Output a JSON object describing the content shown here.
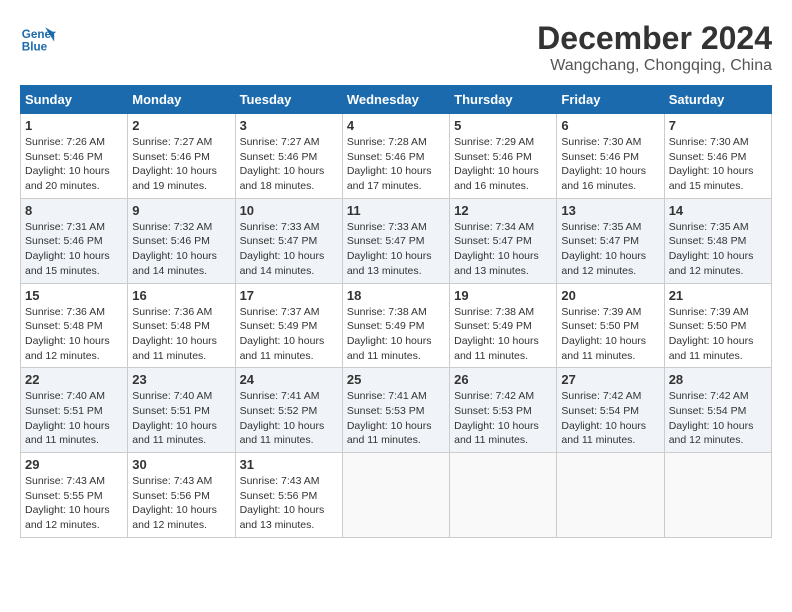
{
  "header": {
    "logo_line1": "General",
    "logo_line2": "Blue",
    "month": "December 2024",
    "location": "Wangchang, Chongqing, China"
  },
  "weekdays": [
    "Sunday",
    "Monday",
    "Tuesday",
    "Wednesday",
    "Thursday",
    "Friday",
    "Saturday"
  ],
  "weeks": [
    [
      {
        "day": "1",
        "info": "Sunrise: 7:26 AM\nSunset: 5:46 PM\nDaylight: 10 hours\nand 20 minutes."
      },
      {
        "day": "2",
        "info": "Sunrise: 7:27 AM\nSunset: 5:46 PM\nDaylight: 10 hours\nand 19 minutes."
      },
      {
        "day": "3",
        "info": "Sunrise: 7:27 AM\nSunset: 5:46 PM\nDaylight: 10 hours\nand 18 minutes."
      },
      {
        "day": "4",
        "info": "Sunrise: 7:28 AM\nSunset: 5:46 PM\nDaylight: 10 hours\nand 17 minutes."
      },
      {
        "day": "5",
        "info": "Sunrise: 7:29 AM\nSunset: 5:46 PM\nDaylight: 10 hours\nand 16 minutes."
      },
      {
        "day": "6",
        "info": "Sunrise: 7:30 AM\nSunset: 5:46 PM\nDaylight: 10 hours\nand 16 minutes."
      },
      {
        "day": "7",
        "info": "Sunrise: 7:30 AM\nSunset: 5:46 PM\nDaylight: 10 hours\nand 15 minutes."
      }
    ],
    [
      {
        "day": "8",
        "info": "Sunrise: 7:31 AM\nSunset: 5:46 PM\nDaylight: 10 hours\nand 15 minutes."
      },
      {
        "day": "9",
        "info": "Sunrise: 7:32 AM\nSunset: 5:46 PM\nDaylight: 10 hours\nand 14 minutes."
      },
      {
        "day": "10",
        "info": "Sunrise: 7:33 AM\nSunset: 5:47 PM\nDaylight: 10 hours\nand 14 minutes."
      },
      {
        "day": "11",
        "info": "Sunrise: 7:33 AM\nSunset: 5:47 PM\nDaylight: 10 hours\nand 13 minutes."
      },
      {
        "day": "12",
        "info": "Sunrise: 7:34 AM\nSunset: 5:47 PM\nDaylight: 10 hours\nand 13 minutes."
      },
      {
        "day": "13",
        "info": "Sunrise: 7:35 AM\nSunset: 5:47 PM\nDaylight: 10 hours\nand 12 minutes."
      },
      {
        "day": "14",
        "info": "Sunrise: 7:35 AM\nSunset: 5:48 PM\nDaylight: 10 hours\nand 12 minutes."
      }
    ],
    [
      {
        "day": "15",
        "info": "Sunrise: 7:36 AM\nSunset: 5:48 PM\nDaylight: 10 hours\nand 12 minutes."
      },
      {
        "day": "16",
        "info": "Sunrise: 7:36 AM\nSunset: 5:48 PM\nDaylight: 10 hours\nand 11 minutes."
      },
      {
        "day": "17",
        "info": "Sunrise: 7:37 AM\nSunset: 5:49 PM\nDaylight: 10 hours\nand 11 minutes."
      },
      {
        "day": "18",
        "info": "Sunrise: 7:38 AM\nSunset: 5:49 PM\nDaylight: 10 hours\nand 11 minutes."
      },
      {
        "day": "19",
        "info": "Sunrise: 7:38 AM\nSunset: 5:49 PM\nDaylight: 10 hours\nand 11 minutes."
      },
      {
        "day": "20",
        "info": "Sunrise: 7:39 AM\nSunset: 5:50 PM\nDaylight: 10 hours\nand 11 minutes."
      },
      {
        "day": "21",
        "info": "Sunrise: 7:39 AM\nSunset: 5:50 PM\nDaylight: 10 hours\nand 11 minutes."
      }
    ],
    [
      {
        "day": "22",
        "info": "Sunrise: 7:40 AM\nSunset: 5:51 PM\nDaylight: 10 hours\nand 11 minutes."
      },
      {
        "day": "23",
        "info": "Sunrise: 7:40 AM\nSunset: 5:51 PM\nDaylight: 10 hours\nand 11 minutes."
      },
      {
        "day": "24",
        "info": "Sunrise: 7:41 AM\nSunset: 5:52 PM\nDaylight: 10 hours\nand 11 minutes."
      },
      {
        "day": "25",
        "info": "Sunrise: 7:41 AM\nSunset: 5:53 PM\nDaylight: 10 hours\nand 11 minutes."
      },
      {
        "day": "26",
        "info": "Sunrise: 7:42 AM\nSunset: 5:53 PM\nDaylight: 10 hours\nand 11 minutes."
      },
      {
        "day": "27",
        "info": "Sunrise: 7:42 AM\nSunset: 5:54 PM\nDaylight: 10 hours\nand 11 minutes."
      },
      {
        "day": "28",
        "info": "Sunrise: 7:42 AM\nSunset: 5:54 PM\nDaylight: 10 hours\nand 12 minutes."
      }
    ],
    [
      {
        "day": "29",
        "info": "Sunrise: 7:43 AM\nSunset: 5:55 PM\nDaylight: 10 hours\nand 12 minutes."
      },
      {
        "day": "30",
        "info": "Sunrise: 7:43 AM\nSunset: 5:56 PM\nDaylight: 10 hours\nand 12 minutes."
      },
      {
        "day": "31",
        "info": "Sunrise: 7:43 AM\nSunset: 5:56 PM\nDaylight: 10 hours\nand 13 minutes."
      },
      {
        "day": "",
        "info": ""
      },
      {
        "day": "",
        "info": ""
      },
      {
        "day": "",
        "info": ""
      },
      {
        "day": "",
        "info": ""
      }
    ]
  ]
}
